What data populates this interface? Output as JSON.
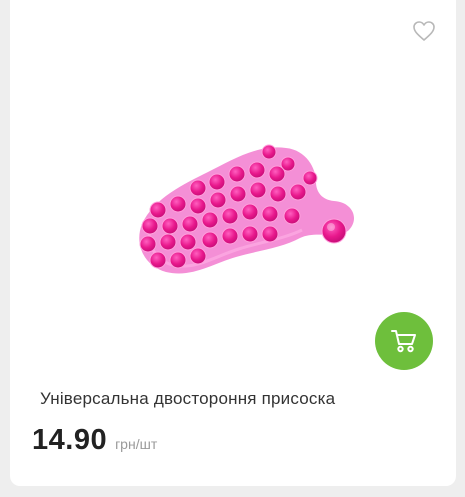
{
  "product": {
    "title": "Універсальна двостороння присоска",
    "price": "14.90",
    "unit": "грн/шт",
    "image_alt": "pink foot-shaped suction cup mat"
  },
  "icons": {
    "favorite": "heart-outline-icon",
    "cart": "cart-icon"
  },
  "colors": {
    "accent": "#6ebf3c",
    "product_pink": "#f06bc8",
    "suction_cup": "#e8188c"
  }
}
